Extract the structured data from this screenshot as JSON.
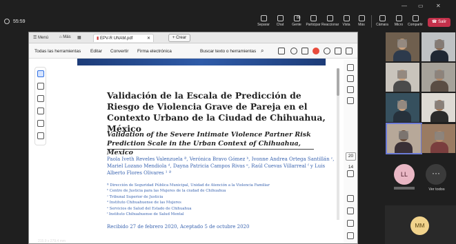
{
  "meeting": {
    "timer": "55:59",
    "toolbar": [
      {
        "label": "Separar",
        "icon": "pop-out-icon"
      },
      {
        "label": "Chat",
        "icon": "chat-icon"
      },
      {
        "label": "Gente",
        "icon": "people-icon",
        "badge": "88"
      },
      {
        "label": "Participar",
        "icon": "raise-hand-icon"
      },
      {
        "label": "Reaccionar",
        "icon": "react-icon"
      },
      {
        "label": "Vista",
        "icon": "view-icon"
      },
      {
        "label": "Más",
        "icon": "more-icon"
      },
      {
        "label": "Cámara",
        "icon": "camera-icon"
      },
      {
        "label": "Micro",
        "icon": "mic-icon"
      },
      {
        "label": "Compartir",
        "icon": "share-icon"
      }
    ],
    "leave_label": "Salir",
    "leave_color": "#c4314b"
  },
  "browser": {
    "menu_label": "Menú",
    "home_label": "Más",
    "tab_title": "EPV-R UNAM.pdf",
    "new_tab_label": "Crear"
  },
  "acrobat": {
    "menu": [
      "Todas las herramientas",
      "Editar",
      "Convertir",
      "Firma electrónica"
    ],
    "search_placeholder": "Buscar texto o herramientas"
  },
  "document": {
    "title_es": "Validación de la Escala de Predicción de Riesgo de Violencia Grave de Pareja en el Contexto Urbano de la Ciudad de Chihuahua, México",
    "title_en": "Validation of the Severe Intimate Violence Partner Risk Prediction Scale in the Urban Context of Chihuahua, Mexico",
    "authors": "Paola Iveth Reveles Valenzuela ª, Verónica Bravo Gómez ᵇ, Ivonne Andrea Ortega Santillán ᶜ, Mariel Lozano Mendiola ᵈ, Dayna Patricia Campos Rivas ᵉ, Raúl Cuevas Villarreal ᶠ y Luis Alberto Flores Olivares ¹ ª",
    "affiliations": [
      "ª Dirección de Seguridad Pública Municipal, Unidad de Atención a la Violencia Familiar",
      "ᵇ Centro de Justicia para las Mujeres de la ciudad de Chihuahua",
      "ᶜ Tribunal Superior de Justicia",
      "ᵈ Instituto Chihuahuense de las Mujeres",
      "ᵉ Servicios de Salud del Estado de Chihuahua",
      "ᶠ Instituto Chihuahuense de Salud Mental"
    ],
    "received": "Recibido 27 de febrero 2020, Aceptado 5 de octubre 2020",
    "page_current": "20",
    "page_total": "14",
    "dimensions": "215.9 x 279.4 mm"
  },
  "participants": {
    "avatar_ll": "LL",
    "avatar_mm": "MM",
    "see_all_label": "Ver todos"
  }
}
